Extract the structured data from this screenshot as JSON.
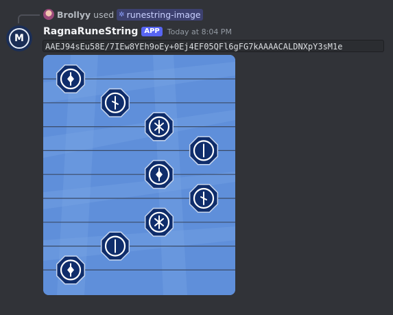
{
  "reply": {
    "username": "Brollyy",
    "used_text": "used",
    "command": "runestring-image",
    "command_icon": "slash-command-icon"
  },
  "message": {
    "avatar_letter": "M",
    "username": "RagnaRuneString",
    "badge": "APP",
    "timestamp": "Today at 8:04 PM",
    "code": "AAEJ94sEu58E/7IEw8YEh9oEy+0Ej4EF05QFl6gFG7kAAAACALDNXpY3sM1e"
  },
  "rune_image": {
    "lines": 9,
    "runes": [
      {
        "lane": 0,
        "row": 0,
        "glyph": "diamond-rune"
      },
      {
        "lane": 1,
        "row": 1,
        "glyph": "tick-rune"
      },
      {
        "lane": 2,
        "row": 2,
        "glyph": "asterisk-rune"
      },
      {
        "lane": 3,
        "row": 3,
        "glyph": "bar-rune"
      },
      {
        "lane": 2,
        "row": 4,
        "glyph": "diamond-rune"
      },
      {
        "lane": 3,
        "row": 5,
        "glyph": "tick-rune"
      },
      {
        "lane": 2,
        "row": 6,
        "glyph": "asterisk-rune"
      },
      {
        "lane": 1,
        "row": 7,
        "glyph": "bar-rune"
      },
      {
        "lane": 0,
        "row": 8,
        "glyph": "diamond-rune"
      }
    ],
    "colors": {
      "background": "#5f8fda",
      "rune_fill": "#0f2d6b",
      "rune_ring": "#ffffff",
      "line": "#3a4a66"
    }
  }
}
